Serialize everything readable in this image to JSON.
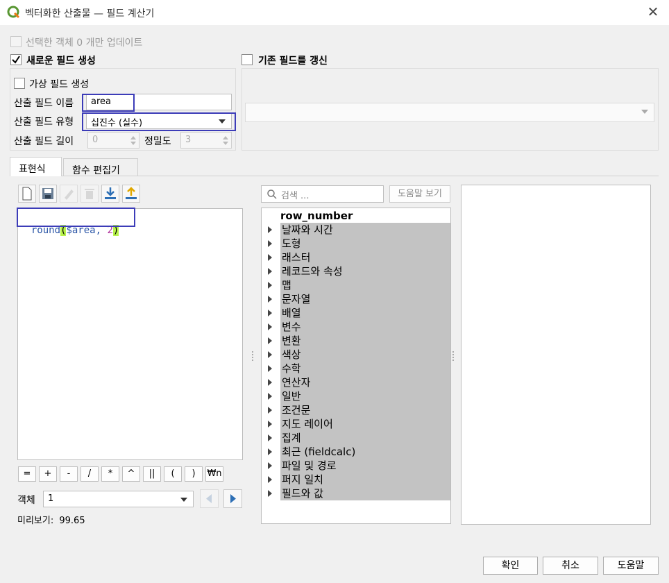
{
  "window": {
    "title": "벡터화한 산출물 — 필드 계산기"
  },
  "update_selected": {
    "label": "선택한 객체 0 개만 업데이트"
  },
  "create_field": {
    "label": "새로운 필드 생성",
    "virtual_label": "가상 필드 생성",
    "name_label": "산출 필드 이름",
    "name_value": "area",
    "type_label": "산출 필드 유형",
    "type_value": "십진수 (실수)",
    "length_label": "산출 필드 길이",
    "length_value": "0",
    "precision_label": "정밀도",
    "precision_value": "3"
  },
  "update_field": {
    "label": "기존 필드를 갱신"
  },
  "tabs": [
    "표현식",
    "함수 편집기"
  ],
  "expression": {
    "func": "round",
    "open": "(",
    "args": "$area, ",
    "num": "2",
    "close": ")"
  },
  "operators": [
    "=",
    "+",
    "-",
    "/",
    "*",
    "^",
    "||",
    "(",
    ")",
    "₩n"
  ],
  "feature": {
    "label": "객체",
    "value": "1"
  },
  "preview": {
    "label": "미리보기:",
    "value": "99.65"
  },
  "search": {
    "placeholder": "검색 ...",
    "help_button": "도움말 보기"
  },
  "function_tree": {
    "top_item": "row_number",
    "groups": [
      "날짜와 시간",
      "도형",
      "래스터",
      "레코드와 속성",
      "맵",
      "문자열",
      "배열",
      "변수",
      "변환",
      "색상",
      "수학",
      "연산자",
      "일반",
      "조건문",
      "지도 레이어",
      "집계",
      "최근 (fieldcalc)",
      "파일 및 경로",
      "퍼지 일치",
      "필드와 값"
    ]
  },
  "footer": {
    "ok": "확인",
    "cancel": "취소",
    "help": "도움말"
  },
  "colors": {
    "highlight": "#b8f34c",
    "selection_box": "#3c3cb8",
    "tree_bg": "#c3c3c3"
  }
}
